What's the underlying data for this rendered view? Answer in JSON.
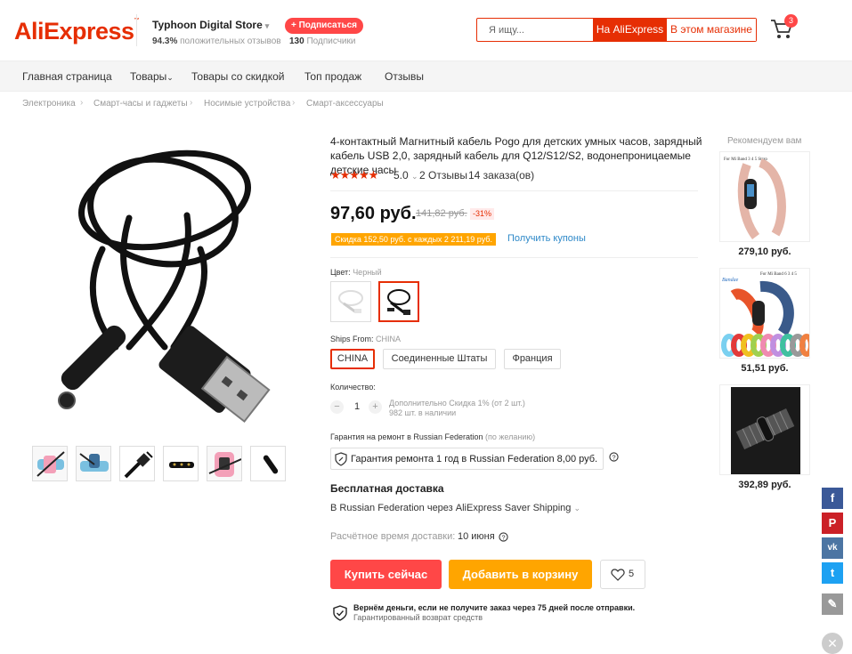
{
  "header": {
    "logo": "AliExpress",
    "logo_tm": "™",
    "store_name": "Typhoon Digital Store",
    "store_rating_value": "94.3%",
    "store_rating_label": "положительных отзывов",
    "follow_label": "+ Подписаться",
    "followers_count": "130",
    "followers_label": "Подписчики",
    "search_placeholder": "Я ищу...",
    "search_ali_label": "На AliExpress",
    "search_store_label": "В этом магазине",
    "cart_count": "3"
  },
  "nav": {
    "items": [
      "Главная страница",
      "Товары",
      "Товары со скидкой",
      "Топ продаж",
      "Отзывы"
    ]
  },
  "breadcrumb": [
    "Электроника",
    "Смарт-часы и гаджеты",
    "Носимые устройства",
    "Смарт-аксессуары"
  ],
  "product": {
    "title": "4-контактный Магнитный кабель Pogo для детских умных часов, зарядный кабель USB 2,0, зарядный кабель для Q12/S12/S2, водонепроницаемые детские часы",
    "stars": "★★★★★",
    "rating": "5.0",
    "reviews": "2 Отзывы",
    "orders": "14 заказа(ов)",
    "price": "97,60 руб.",
    "old_price": "141,82 руб.",
    "discount": "-31%",
    "coupon_tag": "Скидка 152,50 руб. с каждых 2 211,19 руб.",
    "coupon_link": "Получить купоны",
    "color_label": "Цвет:",
    "color_value": "Черный",
    "ships_from_label": "Ships From:",
    "ships_from_value": "CHINA",
    "ship_options": [
      "CHINA",
      "Соединенные Штаты",
      "Франция"
    ],
    "quantity_label": "Количество:",
    "quantity": "1",
    "qty_minus": "−",
    "qty_plus": "+",
    "qty_note1": "Дополнительно Скидка 1% (от 2 шт.)",
    "qty_note2": "982 шт. в наличии",
    "warranty_label": "Гарантия на ремонт в Russian Federation",
    "warranty_label_note": "(по желанию)",
    "warranty_option": "Гарантия ремонта 1 год в Russian Federation 8,00 руб.",
    "shipping_title": "Бесплатная доставка",
    "shipping_desc": "В Russian Federation через AliExpress Saver Shipping",
    "delivery_label": "Расчётное время доставки:",
    "delivery_date": "10 июня",
    "buy_label": "Купить сейчас",
    "cart_label": "Добавить в корзину",
    "wish_count": "5",
    "guarantee_main": "Вернём деньги, если не получите заказ через 75 дней после отправки.",
    "guarantee_sub": "Гарантированный возврат средств"
  },
  "recommended": {
    "title": "Рекомендуем вам",
    "items": [
      {
        "price": "279,10 руб.",
        "caption": "For Mi Band 3 4 5 Strap"
      },
      {
        "price": "51,51 руб.",
        "caption": "For Mi Band 6 3 4 5"
      },
      {
        "price": "392,89 руб.",
        "caption": ""
      }
    ]
  },
  "social": [
    "f",
    "P",
    "vk",
    "t",
    "✎"
  ],
  "colors": {
    "brand": "#e62e04",
    "buy": "#ff4747",
    "cart": "#ffa500",
    "facebook": "#3b5998",
    "pinterest": "#cb2027",
    "vk": "#4c75a3",
    "twitter": "#1da1f2",
    "edit": "#999999"
  }
}
